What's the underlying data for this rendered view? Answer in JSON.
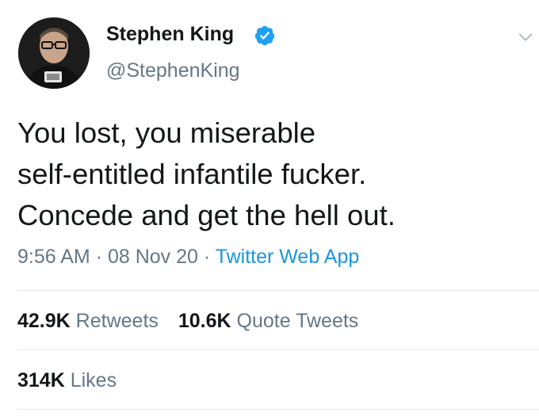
{
  "author": {
    "name": "Stephen King",
    "handle": "@StephenKing",
    "verified": true
  },
  "tweet": {
    "text": "You lost, you miserable\nself-entitled infantile fucker.\nConcede and get the hell out.",
    "time": "9:56 AM",
    "date": "08 Nov 20",
    "separator": "·",
    "source": "Twitter Web App"
  },
  "stats": {
    "retweets_count": "42.9K",
    "retweets_label": "Retweets",
    "quote_count": "10.6K",
    "quote_label": "Quote Tweets",
    "likes_count": "314K",
    "likes_label": "Likes"
  },
  "icons": {
    "verified": "verified-badge-icon",
    "menu": "chevron-down-icon"
  },
  "colors": {
    "text": "#14171a",
    "secondary": "#657786",
    "link": "#1b95e0",
    "verified": "#1da1f2",
    "divider": "#e1e8ed"
  }
}
